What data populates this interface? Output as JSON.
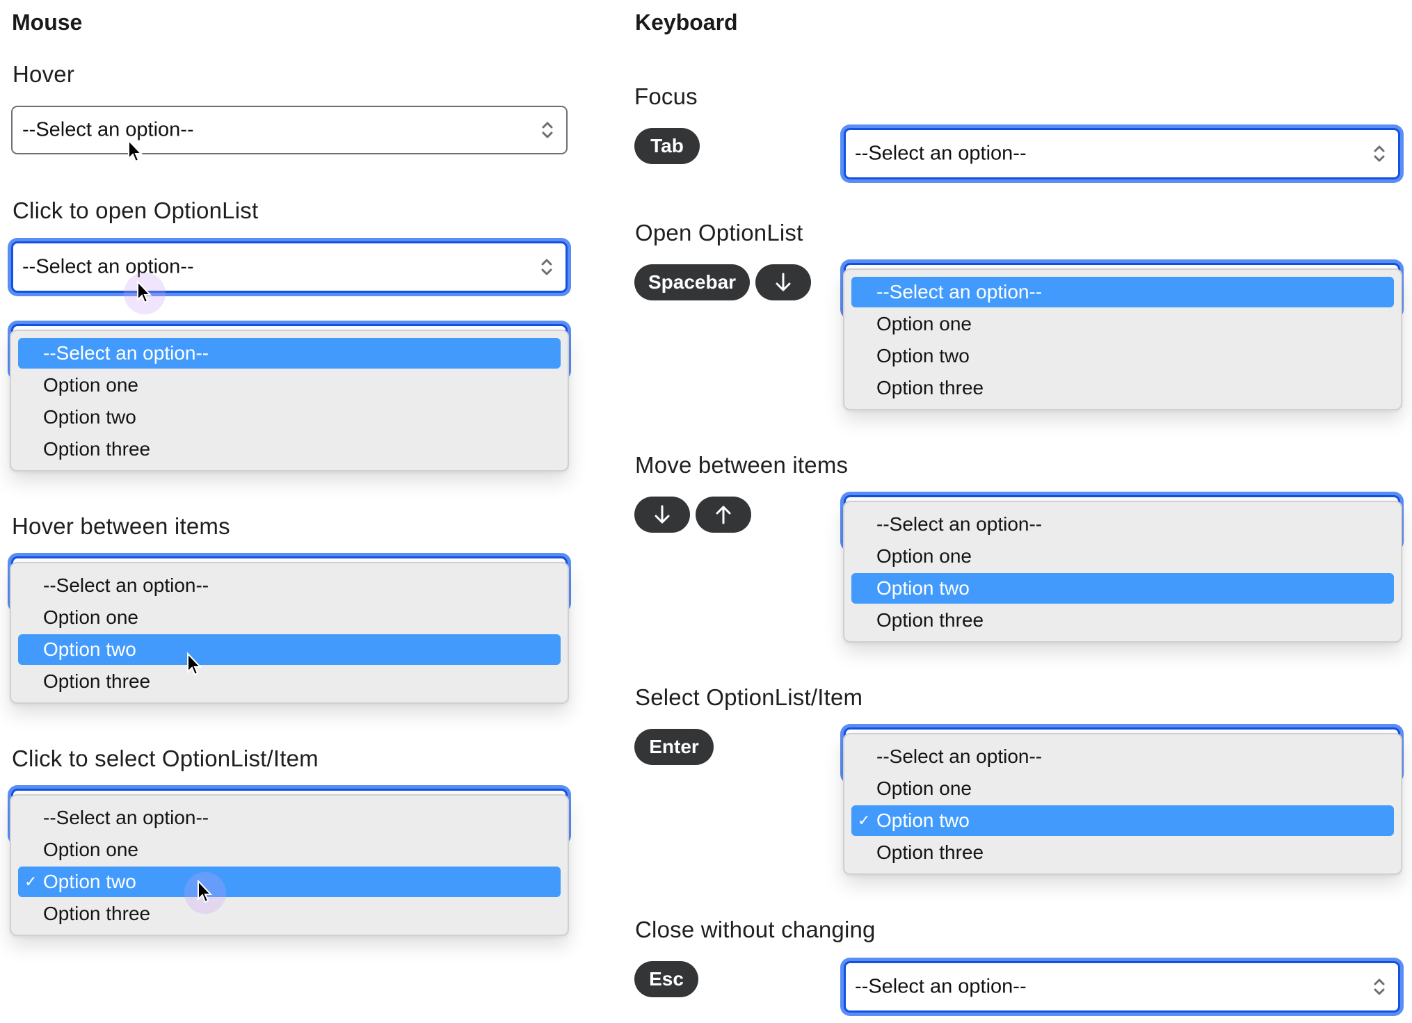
{
  "colors": {
    "focus_ring": "#5b8ef5",
    "focus_border": "#1352e0",
    "highlight": "#429bfc",
    "key_bg": "#343537",
    "list_bg": "#ececed"
  },
  "mouse": {
    "title": "Mouse",
    "hover": {
      "title": "Hover",
      "value": "--Select an option--"
    },
    "click_open": {
      "title": "Click to open OptionList",
      "value": "--Select an option--"
    },
    "hover_items": {
      "title": "Hover between items"
    },
    "click_select": {
      "title": "Click to select OptionList/Item"
    }
  },
  "keyboard": {
    "title": "Keyboard",
    "focus": {
      "title": "Focus",
      "keys": [
        "Tab"
      ],
      "value": "--Select an option--"
    },
    "open": {
      "title": "Open OptionList",
      "keys": [
        "Spacebar",
        "arrow-down"
      ]
    },
    "move": {
      "title": "Move between items",
      "keys": [
        "arrow-down",
        "arrow-up"
      ]
    },
    "select": {
      "title": "Select OptionList/Item",
      "keys": [
        "Enter"
      ]
    },
    "close": {
      "title": "Close without changing",
      "keys": [
        "Esc"
      ],
      "value": "--Select an option--"
    }
  },
  "options": [
    "--Select an option--",
    "Option one",
    "Option two",
    "Option three"
  ],
  "lists": {
    "mouse_open": {
      "highlighted": 0,
      "checked": null
    },
    "mouse_hover": {
      "highlighted": 2,
      "checked": null
    },
    "mouse_select": {
      "highlighted": 2,
      "checked": 2
    },
    "kb_open": {
      "highlighted": 0,
      "checked": null
    },
    "kb_move": {
      "highlighted": 2,
      "checked": null
    },
    "kb_select": {
      "highlighted": 2,
      "checked": 2
    }
  },
  "check_glyph": "✓"
}
